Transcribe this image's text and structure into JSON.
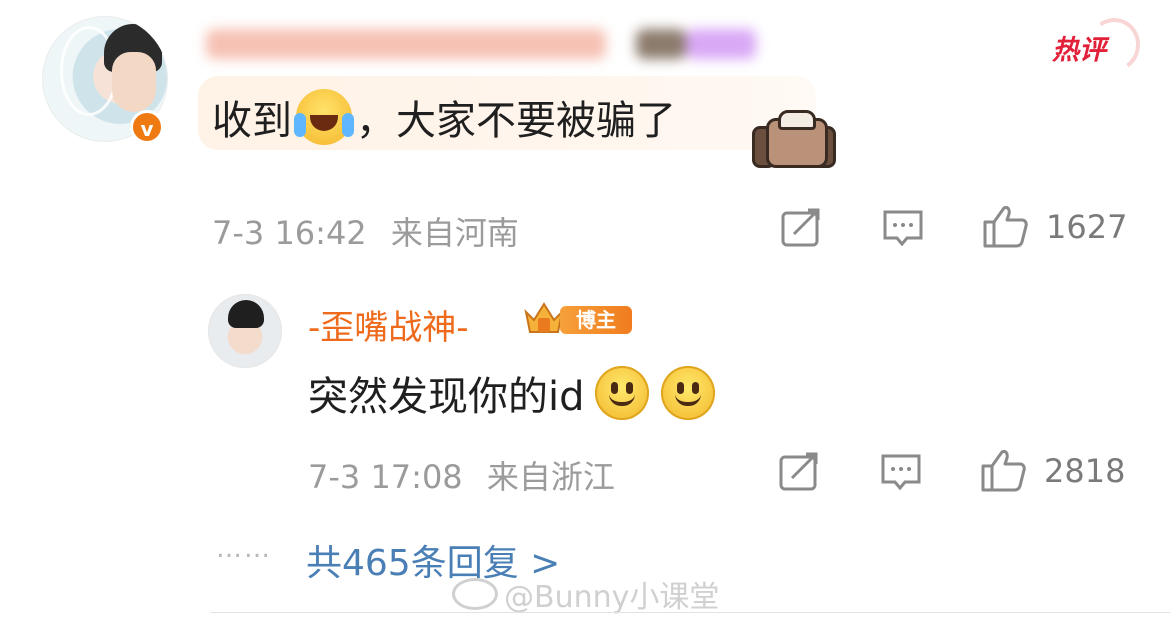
{
  "main_comment": {
    "badge_hot": "热评",
    "text_part1": "收到",
    "text_part2": "，大家不要被骗了",
    "timestamp": "7-3 16:42",
    "location": "来自河南",
    "like_count": "1627",
    "icons": {
      "avatar": "user-avatar",
      "verified": "verified-badge",
      "emoji": "laughing-crying-emoji",
      "sticker": "jacket-sticker",
      "share": "share-icon",
      "comment": "comment-icon",
      "like": "thumbs-up-icon"
    }
  },
  "reply": {
    "username": "-歪嘴战神-",
    "badge_label": "博主",
    "text": "突然发现你的id",
    "timestamp": "7-3 17:08",
    "location": "来自浙江",
    "like_count": "2818",
    "icons": {
      "avatar": "user-avatar",
      "emoji_1": "smile-emoji",
      "emoji_2": "smile-emoji",
      "share": "share-icon",
      "comment": "comment-icon",
      "like": "thumbs-up-icon"
    }
  },
  "more_replies": {
    "dots": "……",
    "label": "共465条回复 >"
  },
  "watermark": "@Bunny小课堂",
  "colors": {
    "accent_orange": "#ee6a1c",
    "link_blue": "#4a7fb6",
    "hot_red": "#e2203a",
    "meta_gray": "#9b9b9b"
  }
}
